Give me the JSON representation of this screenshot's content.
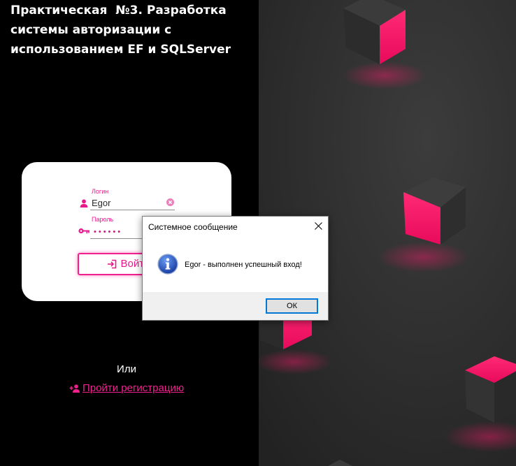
{
  "title": {
    "lines": [
      "Практическая  №3. Разработка",
      "системы авторизации с",
      "использованием EF и SQLServer"
    ]
  },
  "login_form": {
    "login_label": "Логин",
    "login_value": "Egor",
    "password_label": "Пароль",
    "password_masked": "••••••",
    "submit_label": "Войти"
  },
  "or_text": "Или",
  "register_link": {
    "label": "Пройти регистрацию"
  },
  "dialog": {
    "title": "Системное сообщение",
    "message": "Egor - выполнен успешный вход!",
    "ok_label": "ОК"
  },
  "icons": {
    "login_field": "person-icon",
    "login_clear": "clear-icon",
    "password_field": "key-icon",
    "submit": "login-icon",
    "register": "add-user-icon",
    "dialog_type": "info-icon",
    "dialog_close": "close-icon"
  },
  "colors": {
    "accent": "#ee1c8c",
    "left_background": "#000000",
    "scene_background": "#2e2e2e",
    "cube_pink": "#ff1466",
    "cube_gray": "#333333",
    "dialog_footer": "#f0f0f0",
    "default_button_border": "#0078d7"
  }
}
